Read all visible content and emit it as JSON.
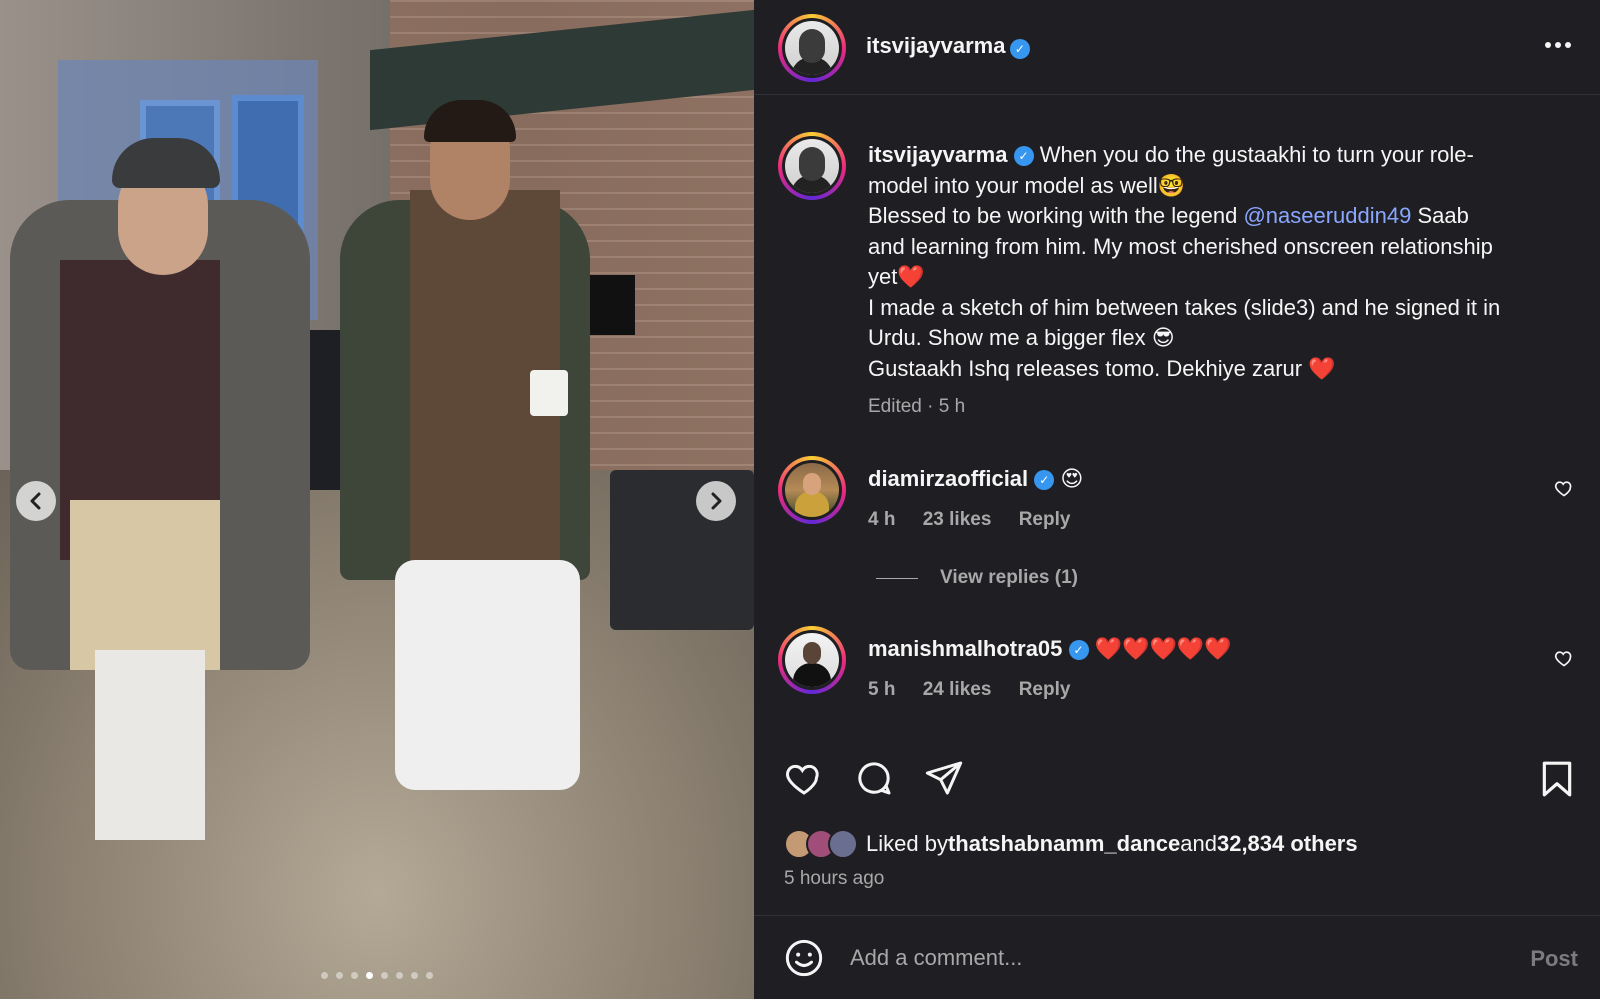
{
  "photo": {
    "prev_icon": "chevron-left-icon",
    "next_icon": "chevron-right-icon",
    "slide_count": 8,
    "active_slide": 4
  },
  "post": {
    "author": "itsvijayvarma",
    "more_icon": "more-horizontal-icon",
    "verified_icon": "verified-badge-icon",
    "caption_lines": [
      "When you do the gustaakhi to turn your role-",
      "model into your model as well🤓",
      "Blessed to be working with the legend ",
      "and learning from him. My most cherished onscreen relationship",
      "yet❤️",
      "I made a sketch of him between takes (slide3) and he signed it in",
      "Urdu. Show me a bigger flex 😎",
      "Gustaakh Ishq releases tomo. Dekhiye zarur ❤️"
    ],
    "mention": "@naseeruddin49",
    "after_mention": " Saab",
    "meta": "Edited · 5 h"
  },
  "comments": [
    {
      "username": "diamirzaofficial",
      "text": "😍",
      "time": "4 h",
      "likes": "23 likes",
      "reply": "Reply"
    },
    {
      "username": "manishmalhotra05",
      "text": "❤️❤️❤️❤️❤️",
      "time": "5 h",
      "likes": "24 likes",
      "reply": "Reply"
    }
  ],
  "view_replies": "View replies (1)",
  "actions": {
    "like_icon": "heart-icon",
    "comment_icon": "comment-icon",
    "share_icon": "send-icon",
    "save_icon": "bookmark-icon"
  },
  "likes": {
    "prefix": "Liked by ",
    "user": "thatshabnamm_dance",
    "middle": " and ",
    "others": "32,834 others"
  },
  "time_ago": "5 hours ago",
  "comment_box": {
    "placeholder": "Add a comment...",
    "post_label": "Post",
    "emoji_icon": "smiley-icon"
  }
}
